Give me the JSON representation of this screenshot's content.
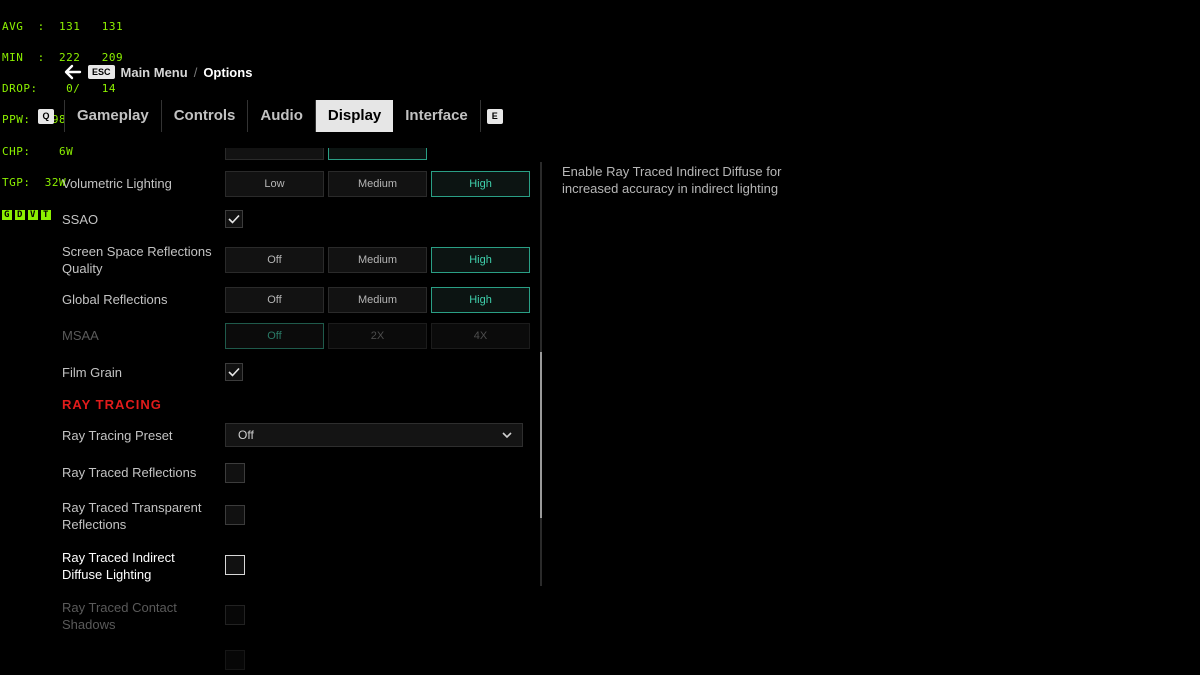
{
  "perf": {
    "lines": [
      "AVG  :  131   131",
      "MIN  :  222   209",
      "DROP:    0/   14",
      "PPW: 3.98",
      "CHP:    6W",
      "TGP:  32W"
    ],
    "flags": [
      "G",
      "D",
      "V",
      "T"
    ]
  },
  "breadcrumb": {
    "esc_key": "ESC",
    "parent": "Main Menu",
    "separator": "/",
    "current": "Options"
  },
  "tabs": {
    "prev_key": "Q",
    "next_key": "E",
    "items": [
      "Gameplay",
      "Controls",
      "Audio",
      "Display",
      "Interface"
    ],
    "active": "Display"
  },
  "settings": {
    "volumetric": {
      "label": "Volumetric Lighting",
      "options": [
        "Low",
        "Medium",
        "High"
      ],
      "selected": "High"
    },
    "ssao": {
      "label": "SSAO",
      "checked": true
    },
    "ssr": {
      "label": "Screen Space Reflections Quality",
      "options": [
        "Off",
        "Medium",
        "High"
      ],
      "selected": "High"
    },
    "global_refl": {
      "label": "Global Reflections",
      "options": [
        "Off",
        "Medium",
        "High"
      ],
      "selected": "High"
    },
    "msaa": {
      "label": "MSAA",
      "options": [
        "Off",
        "2X",
        "4X"
      ],
      "selected": "Off",
      "disabled": true
    },
    "film_grain": {
      "label": "Film Grain",
      "checked": true
    },
    "rt_section": "RAY TRACING",
    "rt_preset": {
      "label": "Ray Tracing Preset",
      "value": "Off"
    },
    "rt_reflections": {
      "label": "Ray Traced Reflections",
      "checked": false
    },
    "rt_transparent": {
      "label": "Ray Traced Transparent Reflections",
      "checked": false
    },
    "rt_indirect": {
      "label": "Ray Traced Indirect Diffuse Lighting",
      "checked": false,
      "focused": true
    },
    "rt_contact": {
      "label": "Ray Traced Contact Shadows",
      "checked": false,
      "disabled": true
    }
  },
  "description": "Enable Ray Traced Indirect Diffuse for increased accuracy in indirect lighting",
  "colors": {
    "accent": "#3fd0ac",
    "section": "#e21b1b",
    "perf": "#8cf000"
  }
}
